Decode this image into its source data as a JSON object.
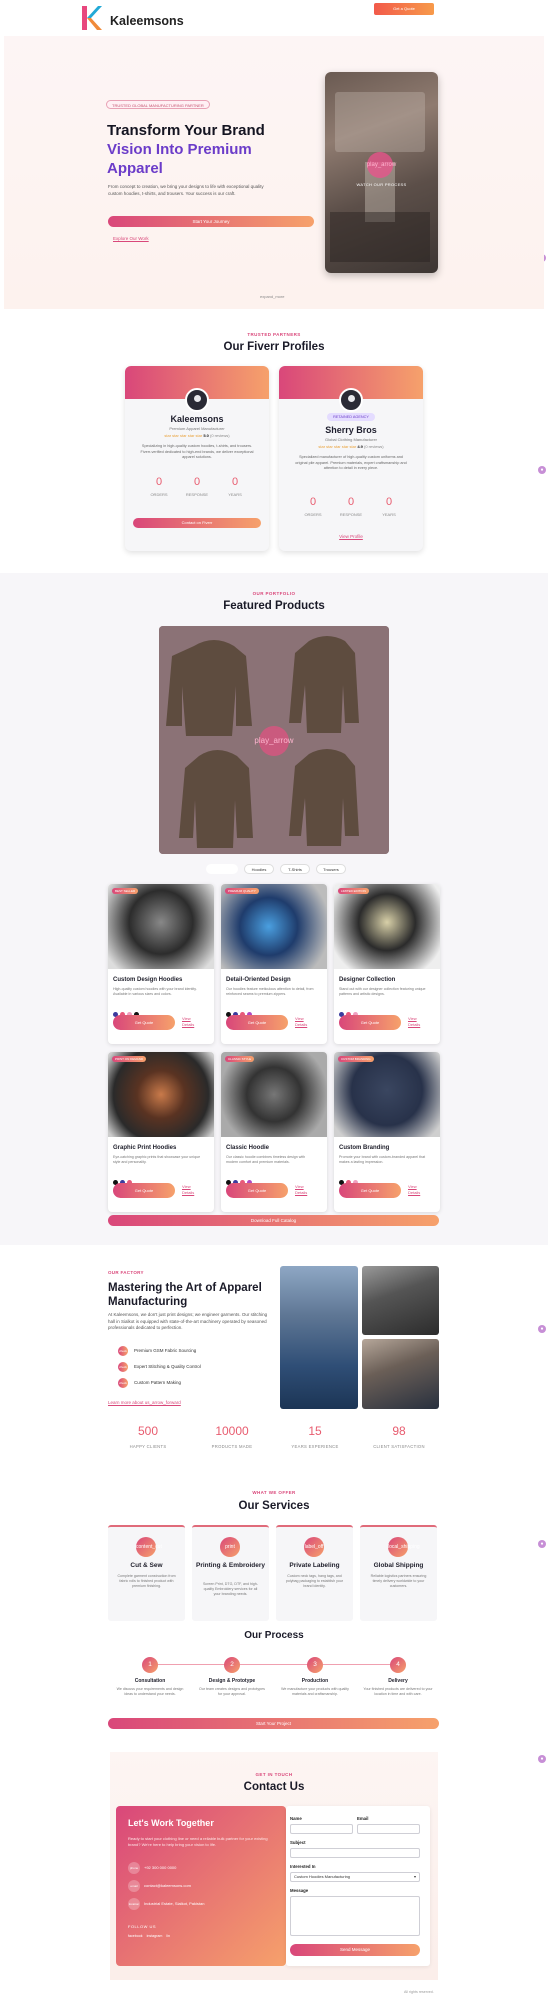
{
  "header": {
    "brand": "Kaleemsons",
    "quote_button": "Get a Quote"
  },
  "hero": {
    "tag": "TRUSTED GLOBAL MANUFACTURING PARTNER",
    "title_line1": "Transform Your Brand",
    "title_line2": "Vision Into Premium",
    "title_line3": "Apparel",
    "paragraph": "From concept to creation, we bring your designs to life with exceptional quality custom hoodies, t-shirts, and trousers. Your success is our craft.",
    "cta": "Start Your Journey",
    "link": "Explore Our Work",
    "video_play": "play_arrow",
    "video_label": "WATCH OUR PROCESS",
    "scroll_hint": "expand_more"
  },
  "profiles": {
    "eyebrow": "TRUSTED PARTNERS",
    "title": "Our Fiverr Profiles",
    "cards": [
      {
        "name": "Kaleemsons",
        "role": "Premium Apparel Manufacturer",
        "stars": "star star star star star",
        "rating": "5.0",
        "reviews": "(0 reviews)",
        "description": "Specializing in high-quality custom hoodies, t-shirts, and trousers. Fiverr-verified dedicated to high-end brands, we deliver exceptional apparel solutions.",
        "stats": [
          {
            "value": "0",
            "label": "ORDERS"
          },
          {
            "value": "0",
            "label": "RESPONSE"
          },
          {
            "value": "0",
            "label": "YEARS"
          }
        ],
        "button": "Contact on Fiverr"
      },
      {
        "badge": "RETAINED AGENCY",
        "name": "Sherry Bros",
        "role": "Global Clothing Manufacturer",
        "stars": "star star star star star",
        "rating": "4.9",
        "reviews": "(0 reviews)",
        "description": "Specialized manufacturer of high-quality custom uniforms and original pile apparel. Premium materials, expert craftsmanship and attention to detail in every piece.",
        "stats": [
          {
            "value": "0",
            "label": "ORDERS"
          },
          {
            "value": "0",
            "label": "RESPONSE"
          },
          {
            "value": "0",
            "label": "YEARS"
          }
        ],
        "link": "View Profile"
      }
    ]
  },
  "portfolio": {
    "eyebrow": "OUR PORTFOLIO",
    "title": "Featured Products",
    "video_play": "play_arrow",
    "filters": [
      "All Products",
      "Hoodies",
      "T-Shirts",
      "Trousers"
    ],
    "products": [
      {
        "tag": "BEST SELLER",
        "title": "Custom Design Hoodies",
        "desc": "High-quality custom hoodies with your brand identity. Available in various sizes and colors.",
        "colors": [
          "#3b3b9e",
          "#e8597a",
          "#f0a0c0",
          "#111111"
        ],
        "quote": "Get Quote",
        "view": "View Details"
      },
      {
        "tag": "PREMIUM QUALITY",
        "title": "Detail-Oriented Design",
        "desc": "Our hoodies feature meticulous attention to detail, from reinforced seams to premium zippers.",
        "colors": [
          "#111111",
          "#3b3b9e",
          "#e8597a",
          "#b04ac2"
        ],
        "quote": "Get Quote",
        "view": "View Details"
      },
      {
        "tag": "LIMITED EDITION",
        "title": "Designer Collection",
        "desc": "Stand out with our designer collection featuring unique patterns and artistic designs.",
        "colors": [
          "#3b3b9e",
          "#e8597a",
          "#f0a0c0"
        ],
        "quote": "Get Quote",
        "view": "View Details"
      },
      {
        "tag": "PRINT ON DEMAND",
        "title": "Graphic Print Hoodies",
        "desc": "Eye-catching graphic prints that showcase your unique style and personality.",
        "colors": [
          "#111111",
          "#3b3b9e",
          "#e8597a"
        ],
        "quote": "Get Quote",
        "view": "View Details"
      },
      {
        "tag": "CLASSIC STYLE",
        "title": "Classic Hoodie",
        "desc": "Our classic hoodie combines timeless design with modern comfort and premium materials.",
        "colors": [
          "#111111",
          "#3b3b9e",
          "#e8597a",
          "#b04ac2"
        ],
        "quote": "Get Quote",
        "view": "View Details"
      },
      {
        "tag": "CUSTOM BRANDING",
        "title": "Custom Branding",
        "desc": "Promote your brand with custom-branded apparel that makes a lasting impression.",
        "colors": [
          "#111111",
          "#e8597a",
          "#f0a0c0"
        ],
        "quote": "Get Quote",
        "view": "View Details"
      }
    ],
    "download_button": "Download Full Catalog"
  },
  "factory": {
    "eyebrow": "OUR FACTORY",
    "title": "Mastering the Art of Apparel Manufacturing",
    "paragraph": "At Kaleemsons, we don't just print designs; we engineer garments. Our stitching hall in Sialkot is equipped with state-of-the-art machinery operated by seasoned professionals dedicated to perfection.",
    "features": [
      {
        "icon": "check",
        "text": "Premium GSM Fabric Sourcing"
      },
      {
        "icon": "check",
        "text": "Expert Stitching & Quality Control"
      },
      {
        "icon": "check",
        "text": "Custom Pattern Making"
      }
    ],
    "link": "Learn more about us_arrow_forward",
    "stats": [
      {
        "value": "500",
        "label": "HAPPY CLIENTS"
      },
      {
        "value": "10000",
        "label": "PRODUCTS MADE"
      },
      {
        "value": "15",
        "label": "YEARS EXPERIENCE"
      },
      {
        "value": "98",
        "label": "CLIENT SATISFACTION"
      }
    ]
  },
  "services": {
    "eyebrow": "WHAT WE OFFER",
    "title": "Our Services",
    "items": [
      {
        "icon": "content_cut",
        "title": "Cut & Sew",
        "desc": "Complete garment construction from fabric rolls to finished product with premium finishing."
      },
      {
        "icon": "print",
        "title": "Printing & Embroidery",
        "desc": "Screen Print, DTG, DTF, and high-quality Embroidery services for all your branding needs."
      },
      {
        "icon": "label_off",
        "title": "Private Labeling",
        "desc": "Custom neck tags, hang tags, and polybag packaging to establish your brand identity."
      },
      {
        "icon": "local_shipping",
        "title": "Global Shipping",
        "desc": "Reliable logistics partners ensuring timely delivery worldwide to your customers."
      }
    ]
  },
  "process": {
    "title": "Our Process",
    "steps": [
      {
        "n": "1",
        "title": "Consultation",
        "desc": "We discuss your requirements and design ideas to understand your needs."
      },
      {
        "n": "2",
        "title": "Design & Prototype",
        "desc": "Our team creates designs and prototypes for your approval."
      },
      {
        "n": "3",
        "title": "Production",
        "desc": "We manufacture your products with quality materials and craftsmanship."
      },
      {
        "n": "4",
        "title": "Delivery",
        "desc": "Your finished products are delivered to your location in time and with care."
      }
    ],
    "button": "Start Your Project"
  },
  "contact": {
    "eyebrow": "GET IN TOUCH",
    "title": "Contact Us",
    "info_title": "Let's Work Together",
    "info_desc": "Ready to start your clothing line or need a reliable bulk partner for your existing brand? We're here to help bring your vision to life.",
    "rows": [
      {
        "icon": "phone",
        "text": "+92 300 000 0000"
      },
      {
        "icon": "email",
        "text": "contact@kaleemsons.com"
      },
      {
        "icon": "location",
        "text": "Industrial Estate, Sialkot, Pakistan"
      }
    ],
    "follow": "FOLLOW US",
    "socials": [
      "facebook",
      "instagram",
      "lin"
    ],
    "form": {
      "name_label": "Name",
      "email_label": "Email",
      "subject_label": "Subject",
      "interest_label": "Interested In",
      "interest_value": "Custom Hoodies Manufacturing",
      "message_label": "Message",
      "send_button": "Send Message"
    }
  },
  "footer": {
    "copy": "All rights reserved."
  }
}
